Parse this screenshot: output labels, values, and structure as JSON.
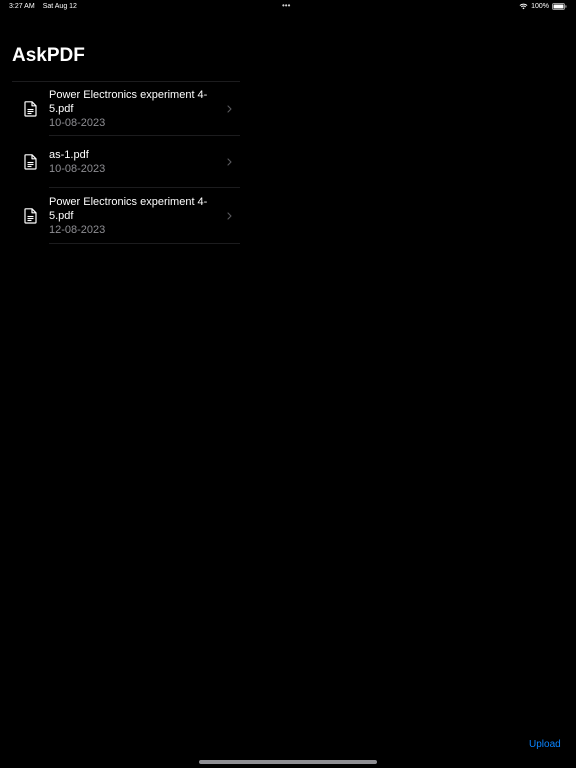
{
  "status_bar": {
    "time": "3:27 AM",
    "date": "Sat Aug 12",
    "center": "•••",
    "battery": "100%"
  },
  "header": {
    "title": "AskPDF"
  },
  "files": [
    {
      "name": "Power Electronics experiment 4-5.pdf",
      "date": "10-08-2023",
      "icon": "document-icon"
    },
    {
      "name": "as-1.pdf",
      "date": "10-08-2023",
      "icon": "document-icon"
    },
    {
      "name": "Power Electronics experiment 4-5.pdf",
      "date": "12-08-2023",
      "icon": "document-icon"
    }
  ],
  "toolbar": {
    "upload_label": "Upload"
  },
  "colors": {
    "background": "#000000",
    "accent": "#0a84ff",
    "secondary_text": "#8e8e93"
  }
}
